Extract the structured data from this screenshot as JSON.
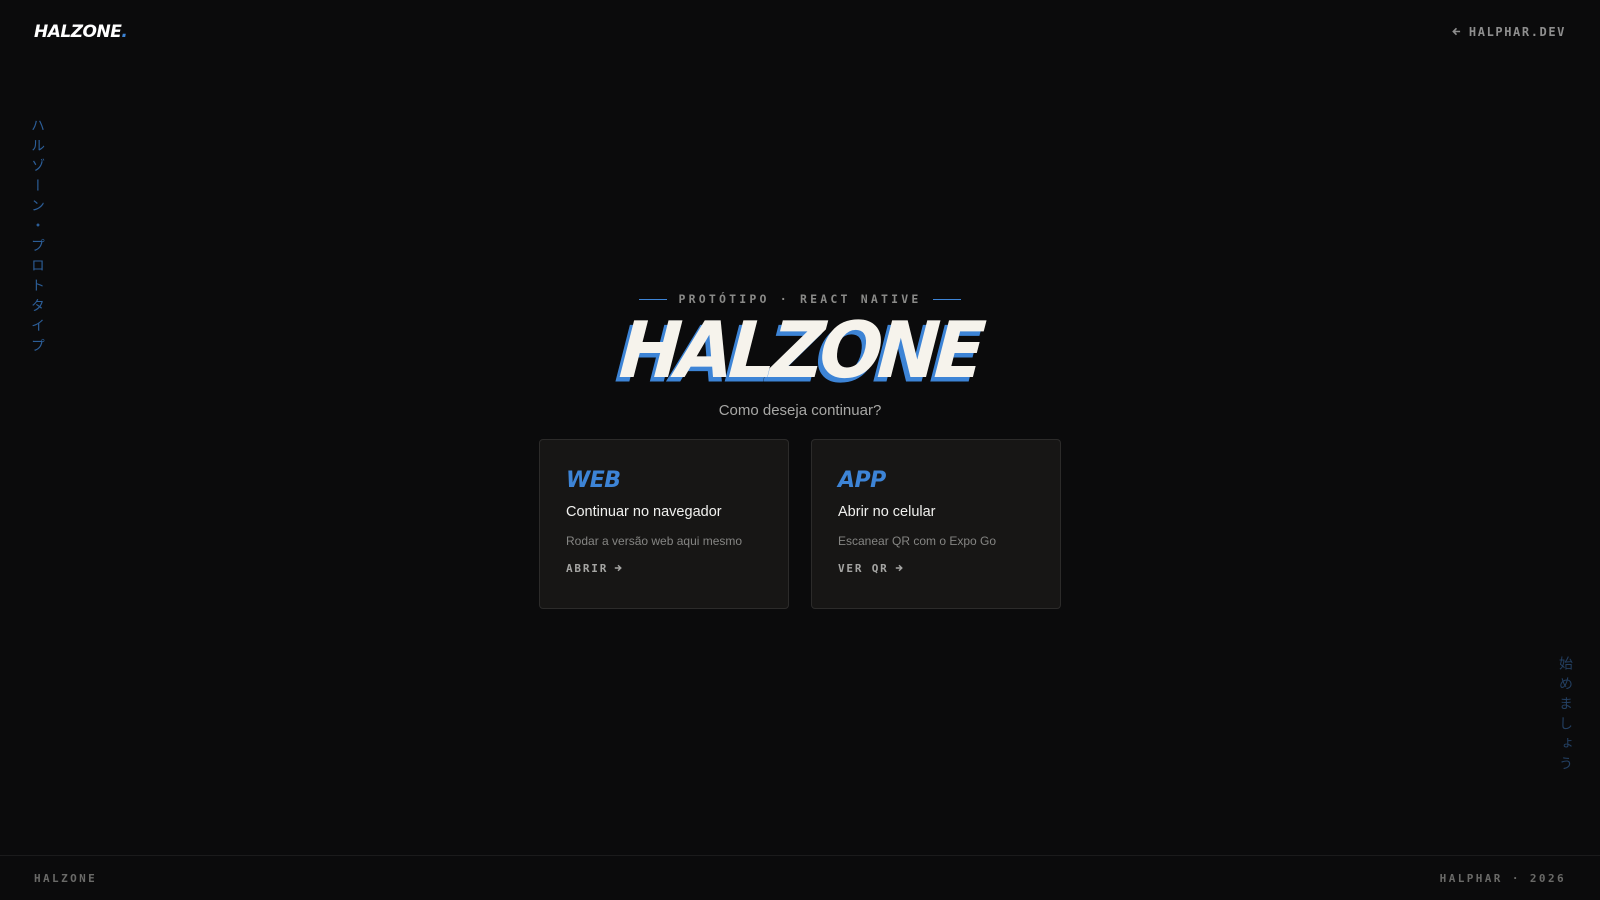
{
  "header": {
    "brand": "HALZONE",
    "brand_dot": ".",
    "back_link": "HALPHAR.DEV",
    "back_icon": "arrow-left-icon"
  },
  "side": {
    "left_vertical": "ハルゾーン・プロトタイプ",
    "right_vertical": "始めましょう"
  },
  "hero": {
    "eyebrow": "PROTÓTIPO · REACT NATIVE",
    "title": "HALZONE",
    "subtitle": "Como deseja continuar?"
  },
  "cards": [
    {
      "tag": "WEB",
      "title": "Continuar no navegador",
      "description": "Rodar a versão web aqui mesmo",
      "cta": "ABRIR",
      "cta_icon": "arrow-right-icon"
    },
    {
      "tag": "APP",
      "title": "Abrir no celular",
      "description": "Escanear QR com o Expo Go",
      "cta": "VER QR",
      "cta_icon": "arrow-right-icon"
    }
  ],
  "footer": {
    "left": "HALZONE",
    "right": "HALPHAR · 2026"
  },
  "colors": {
    "background": "#0b0b0c",
    "accent": "#3d84d6",
    "card": "#171615"
  }
}
